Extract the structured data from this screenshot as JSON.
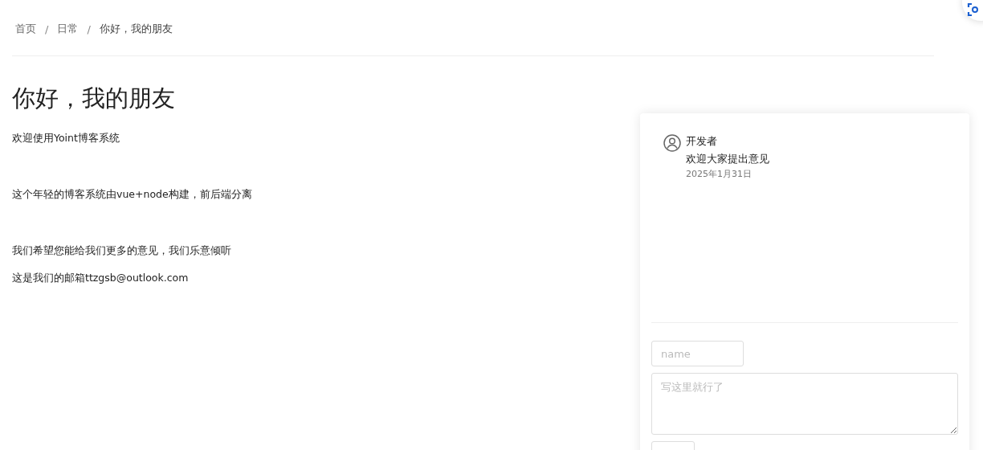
{
  "breadcrumb": [
    "首页",
    "日常",
    "你好，我的朋友"
  ],
  "breadcrumb_separator": "/",
  "title": "你好，我的朋友",
  "paragraphs": [
    "欢迎使用Yoint博客系统",
    "这个年轻的博客系统由vue+node构建，前后端分离",
    "我们希望您能给我们更多的意见，我们乐意倾听",
    "这是我们的邮箱ttzgsb@outlook.com"
  ],
  "comments": [
    {
      "author": "开发者",
      "text": "欢迎大家提出意见",
      "date": "2025年1月31日"
    }
  ],
  "form": {
    "name": {
      "placeholder": "name"
    },
    "content": {
      "placeholder": "写这里就行了"
    }
  }
}
